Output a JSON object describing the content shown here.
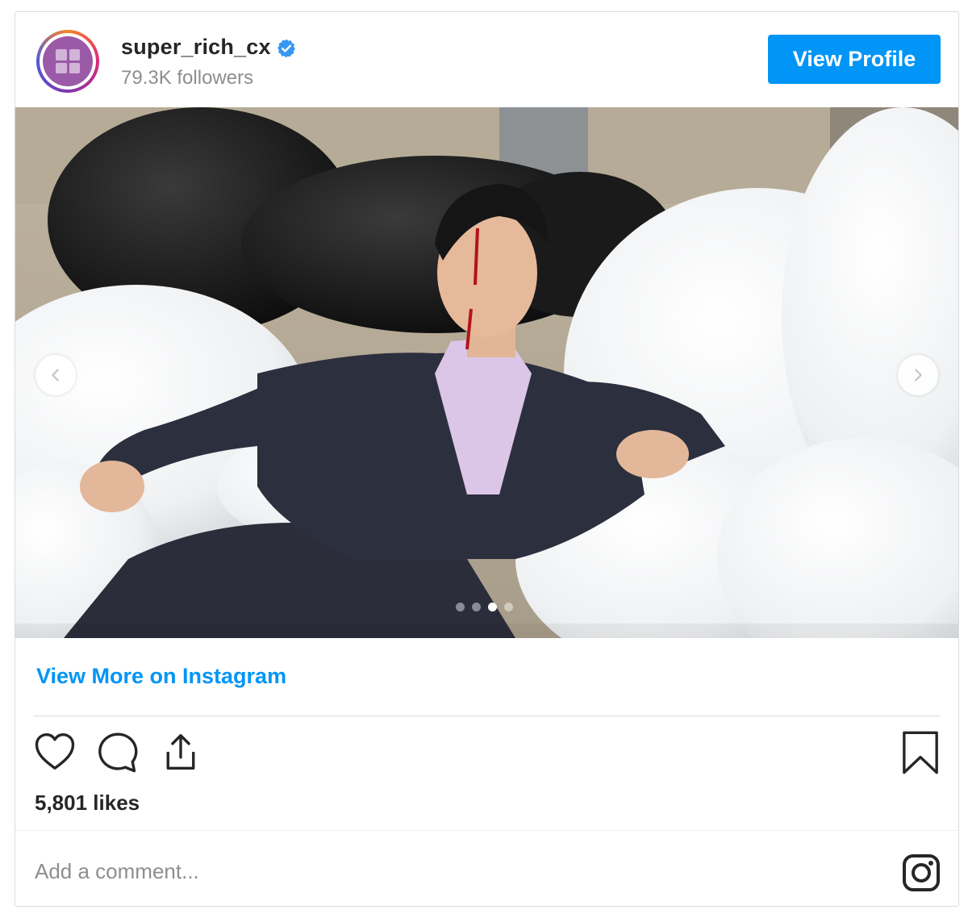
{
  "post": {
    "username": "super_rich_cx",
    "followers": "79.3K followers",
    "view_profile_label": "View Profile",
    "view_more_label": "View More on Instagram",
    "likes": "5,801 likes",
    "comment_placeholder": "Add a comment...",
    "carousel": {
      "total": 4,
      "active_index": 2
    }
  },
  "colors": {
    "accent": "#0095f6",
    "text": "#262626",
    "muted": "#8e8e8e",
    "border": "#dbdbdb",
    "verified": "#3897f0"
  },
  "icons": {
    "verified": "verified-badge-icon",
    "prev": "chevron-left-icon",
    "next": "chevron-right-icon",
    "like": "heart-icon",
    "comment": "comment-bubble-icon",
    "share": "share-icon",
    "save": "bookmark-icon",
    "instagram": "instagram-logo-icon"
  }
}
